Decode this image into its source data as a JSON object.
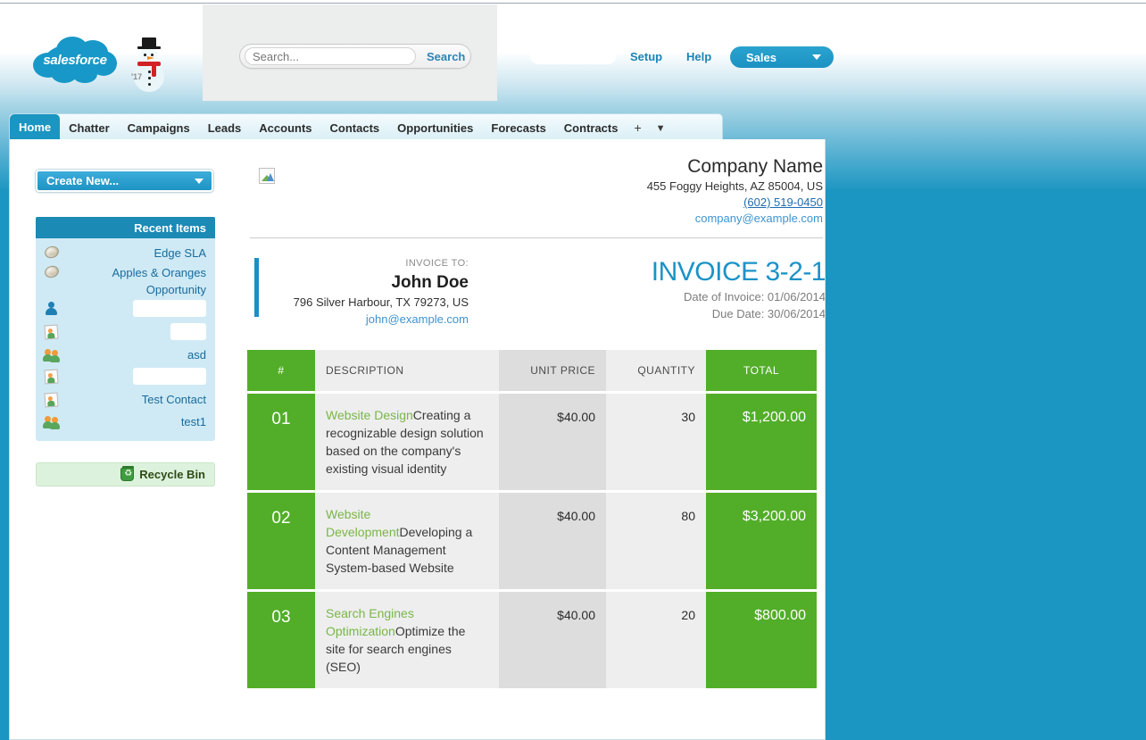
{
  "header": {
    "brand_name": "salesforce",
    "mascot_year": "'17",
    "search": {
      "placeholder": "Search...",
      "value": "",
      "button_label": "Search"
    },
    "user_name_redacted": "",
    "setup_label": "Setup",
    "help_label": "Help",
    "app_selector": {
      "label": "Sales"
    }
  },
  "tabs": [
    {
      "label": "Home",
      "active": true
    },
    {
      "label": "Chatter",
      "active": false
    },
    {
      "label": "Campaigns",
      "active": false
    },
    {
      "label": "Leads",
      "active": false
    },
    {
      "label": "Accounts",
      "active": false
    },
    {
      "label": "Contacts",
      "active": false
    },
    {
      "label": "Opportunities",
      "active": false
    },
    {
      "label": "Forecasts",
      "active": false
    },
    {
      "label": "Contracts",
      "active": false
    }
  ],
  "tab_add_label": "+",
  "tab_more_label": "▼",
  "sidebar": {
    "create_new_label": "Create New...",
    "recent_items_title": "Recent Items",
    "recent_items": [
      {
        "label": "Edge SLA",
        "icon": "opportunity-coin-icon",
        "redacted": false
      },
      {
        "label": "Apples & Oranges Opportunity",
        "icon": "opportunity-coin-icon",
        "redacted": false
      },
      {
        "label": "",
        "icon": "lead-person-icon",
        "redacted": true,
        "redact_width": 82
      },
      {
        "label": "",
        "icon": "contact-card-icon",
        "redacted": true,
        "redact_width": 40
      },
      {
        "label": "asd",
        "icon": "account-group-icon",
        "redacted": false
      },
      {
        "label": "",
        "icon": "contact-card-icon",
        "redacted": true,
        "redact_width": 82
      },
      {
        "label": "Test Contact",
        "icon": "contact-card-icon",
        "redacted": false
      },
      {
        "label": "test1",
        "icon": "account-group-icon",
        "redacted": false
      }
    ],
    "recycle_bin_label": "Recycle Bin"
  },
  "invoice": {
    "company": {
      "name": "Company Name",
      "address": "455 Foggy Heights, AZ 85004, US",
      "phone": "(602) 519-0450",
      "email": "company@example.com"
    },
    "bill_to": {
      "label": "INVOICE TO:",
      "name": "John Doe",
      "address": "796 Silver Harbour, TX 79273, US",
      "email": "john@example.com"
    },
    "number": "INVOICE 3-2-1",
    "date_of_invoice": "Date of Invoice: 01/06/2014",
    "due_date": "Due Date: 30/06/2014",
    "columns": {
      "num": "#",
      "description": "DESCRIPTION",
      "unit_price": "UNIT PRICE",
      "quantity": "QUANTITY",
      "total": "TOTAL"
    },
    "rows": [
      {
        "num": "01",
        "title": "Website Design",
        "desc": "Creating a recognizable design solution based on the company's existing visual identity",
        "unit_price": "$40.00",
        "quantity": "30",
        "total": "$1,200.00"
      },
      {
        "num": "02",
        "title": "Website Development",
        "desc": "Developing a Content Management System-based Website",
        "unit_price": "$40.00",
        "quantity": "80",
        "total": "$3,200.00"
      },
      {
        "num": "03",
        "title": "Search Engines Optimization",
        "desc": "Optimize the site for search engines (SEO)",
        "unit_price": "$40.00",
        "quantity": "20",
        "total": "$800.00"
      }
    ]
  },
  "colors": {
    "sf_blue": "#1b95c1",
    "invoice_green": "#52ae28",
    "invoice_title_green": "#7ab648",
    "invoice_number_blue": "#1b92c8",
    "link_blue": "#3f93cf"
  }
}
